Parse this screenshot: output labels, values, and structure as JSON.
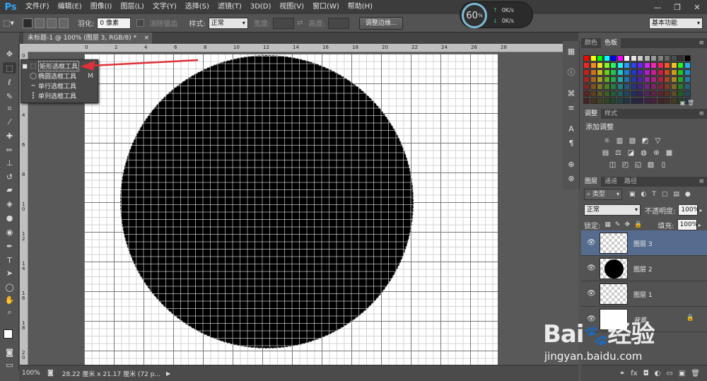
{
  "app": {
    "logo": "Ps",
    "menu": [
      "文件(F)",
      "编辑(E)",
      "图像(I)",
      "图层(L)",
      "文字(Y)",
      "选择(S)",
      "滤镜(T)",
      "3D(D)",
      "视图(V)",
      "窗口(W)",
      "帮助(H)"
    ],
    "window_controls": [
      "—",
      "❐",
      "✕"
    ]
  },
  "options_bar": {
    "feather_label": "羽化:",
    "feather_value": "0 像素",
    "antialias_label": "消除锯齿",
    "style_label": "样式:",
    "style_value": "正常",
    "width_label": "宽度:",
    "height_label": "高度:",
    "refine_button": "调整边缘...",
    "workspace_value": "基本功能"
  },
  "perf_widget": {
    "percent": "60",
    "percent_unit": "%",
    "up": "0K/s",
    "down": "0K/s"
  },
  "document": {
    "tab_title": "未标题-1 @ 100% (图层 3, RGB/8) *",
    "zoom": "100%",
    "doc_info": "28.22 厘米 x 21.17 厘米 (72 p..."
  },
  "ruler": {
    "h_ticks": [
      "0",
      "2",
      "4",
      "6",
      "8",
      "10",
      "12",
      "14",
      "16",
      "18",
      "20",
      "22",
      "24",
      "26",
      "28"
    ],
    "v_ticks": [
      "0",
      "2",
      "4",
      "6",
      "8",
      "1\n0",
      "1\n2",
      "1\n4",
      "1\n6",
      "1\n8",
      "2\n0"
    ]
  },
  "flyout": {
    "items": [
      {
        "label": "矩形选框工具",
        "key": "M",
        "selected": true
      },
      {
        "label": "椭圆选框工具",
        "key": "M",
        "selected": false
      },
      {
        "label": "单行选框工具",
        "key": "",
        "selected": false
      },
      {
        "label": "单列选框工具",
        "key": "",
        "selected": false
      }
    ]
  },
  "swatches_panel": {
    "tabs": [
      "颜色",
      "色板"
    ],
    "active_tab": 1
  },
  "adjust_panel": {
    "tabs": [
      "调整",
      "样式"
    ],
    "title": "添加调整"
  },
  "layers_panel": {
    "tabs": [
      "图层",
      "通道",
      "路径"
    ],
    "filter_label": "类型",
    "blend_mode": "正常",
    "opacity_label": "不透明度:",
    "opacity_value": "100%",
    "lock_label": "锁定:",
    "fill_label": "填充:",
    "fill_value": "100%",
    "layers": [
      {
        "name": "图层 3",
        "type": "empty",
        "selected": true
      },
      {
        "name": "图层 2",
        "type": "circle",
        "selected": false
      },
      {
        "name": "图层 1",
        "type": "empty",
        "selected": false
      },
      {
        "name": "背景",
        "type": "white",
        "selected": false,
        "locked": true
      }
    ]
  },
  "watermark": {
    "brand": "Bai",
    "brand_tail": "经验",
    "url": "jingyan.baidu.com"
  },
  "colors": {
    "accent": "#566c8f",
    "arrow": "#e0303a"
  }
}
